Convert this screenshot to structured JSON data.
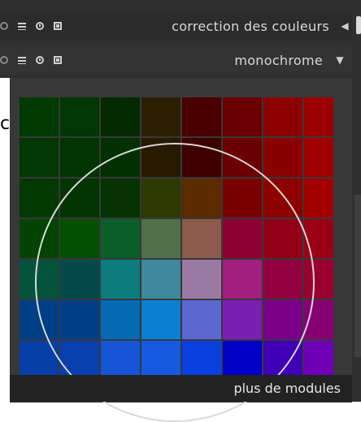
{
  "header_module1": {
    "title": "correction des couleurs",
    "icons": [
      "power-icon",
      "menu-icon",
      "reset-icon",
      "presets-icon",
      "collapse-arrow-icon"
    ]
  },
  "header_module2": {
    "title": "monochrome",
    "icons": [
      "power-icon",
      "menu-icon",
      "reset-icon",
      "presets-icon",
      "expand-arrow-icon"
    ]
  },
  "stray_glyph": "c",
  "color_grid": {
    "rows": 7,
    "cols": 8,
    "colors": [
      [
        "#013a01",
        "#023602",
        "#032a01",
        "#2a1f00",
        "#4a0000",
        "#6a0000",
        "#8c0000",
        "#9c0000"
      ],
      [
        "#023602",
        "#013401",
        "#023001",
        "#271a00",
        "#3e0100",
        "#6b0000",
        "#8a0000",
        "#a00000"
      ],
      [
        "#023a02",
        "#033502",
        "#073203",
        "#2d3a02",
        "#5d2b00",
        "#7a0000",
        "#8e0000",
        "#a50000"
      ],
      [
        "#034402",
        "#045002",
        "#0b5e2a",
        "#4f7048",
        "#8c5a4a",
        "#8c0033",
        "#920018",
        "#9b0015"
      ],
      [
        "#03523b",
        "#054a4a",
        "#0c7c7c",
        "#3e8a9c",
        "#9a7aa2",
        "#a01f7f",
        "#92003f",
        "#9a0031"
      ],
      [
        "#003f86",
        "#033f88",
        "#0669b4",
        "#0b7fd0",
        "#5c68d0",
        "#7a1fb0",
        "#7a008a",
        "#860073"
      ],
      [
        "#063fa8",
        "#0a3faf",
        "#1656d6",
        "#175ae2",
        "#0a3fe0",
        "#0000c9",
        "#3f00b6",
        "#7000b8"
      ]
    ]
  },
  "footer": {
    "label": "plus de modules"
  }
}
